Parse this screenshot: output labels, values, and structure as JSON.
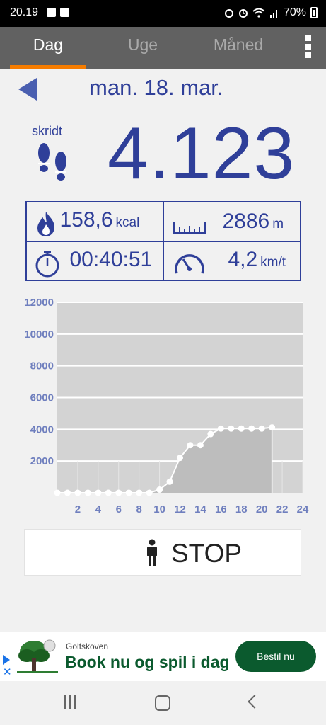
{
  "status_bar": {
    "time": "20.19",
    "battery": "70%"
  },
  "tabs": [
    {
      "label": "Dag",
      "active": true
    },
    {
      "label": "Uge",
      "active": false
    },
    {
      "label": "Måned",
      "active": false
    }
  ],
  "day": {
    "date": "man. 18. mar.",
    "steps_label": "skridt",
    "steps": "4.123"
  },
  "stats": {
    "calories": {
      "value": "158,6",
      "unit": "kcal",
      "icon": "flame-icon"
    },
    "distance": {
      "value": "2886",
      "unit": "m",
      "icon": "ruler-icon"
    },
    "duration": {
      "value": "00:40:51",
      "icon": "stopwatch-icon"
    },
    "speed": {
      "value": "4,2",
      "unit": "km/t",
      "icon": "speedometer-icon"
    }
  },
  "chart_data": {
    "type": "line",
    "x_ticks": [
      "2",
      "4",
      "6",
      "8",
      "10",
      "12",
      "14",
      "16",
      "18",
      "20",
      "22",
      "24"
    ],
    "y_ticks": [
      "2000",
      "4000",
      "6000",
      "8000",
      "10000",
      "12000"
    ],
    "xlim": [
      0,
      24
    ],
    "ylim": [
      0,
      12000
    ],
    "x": [
      0,
      1,
      2,
      3,
      4,
      5,
      6,
      7,
      8,
      9,
      10,
      11,
      12,
      13,
      14,
      15,
      16,
      17,
      18,
      19,
      20,
      21
    ],
    "y": [
      0,
      0,
      0,
      0,
      0,
      0,
      0,
      0,
      0,
      0,
      200,
      700,
      2200,
      3000,
      3000,
      3700,
      4050,
      4050,
      4050,
      4050,
      4050,
      4123
    ],
    "colors": {
      "plot_bg": "#d3d3d3",
      "area": "#bdbdbd",
      "line": "#ffffff",
      "tick_label": "#6f7fbe"
    }
  },
  "stop_button": {
    "label": "STOP"
  },
  "ad": {
    "advertiser": "Golfskoven",
    "headline": "Book nu og spil i dag",
    "cta": "Bestil nu",
    "close": "✕"
  },
  "colors": {
    "accent": "#f57c00",
    "primary": "#2f3f99",
    "tabbar": "#616161"
  }
}
